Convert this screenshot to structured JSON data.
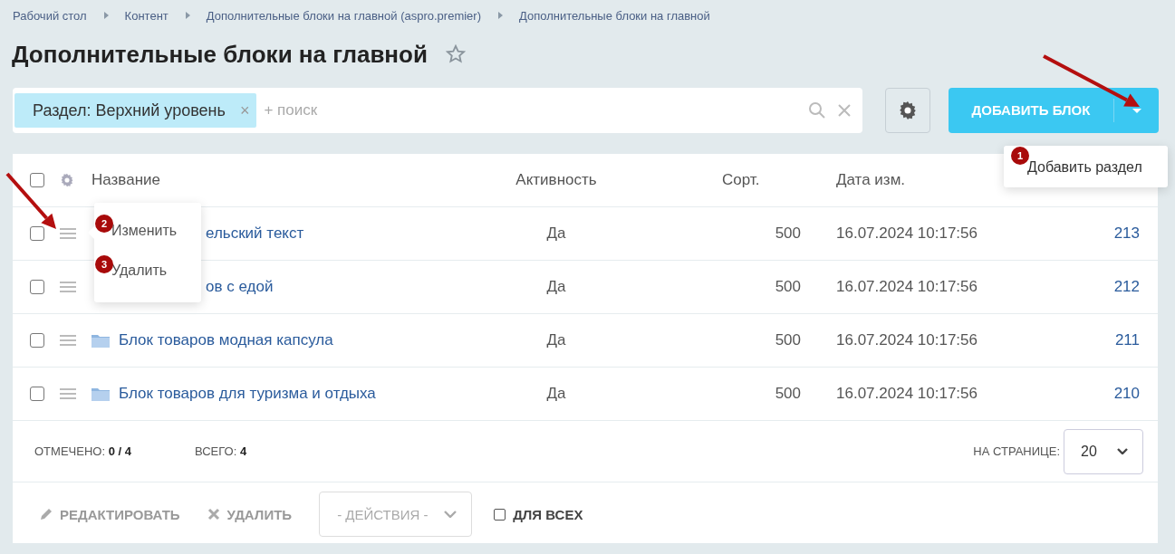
{
  "breadcrumbs": [
    "Рабочий стол",
    "Контент",
    "Дополнительные блоки на главной (aspro.premier)",
    "Дополнительные блоки на главной"
  ],
  "title": "Дополнительные блоки на главной",
  "favorite": false,
  "filter": {
    "tag": "Раздел: Верхний уровень",
    "remove": "×",
    "placeholder": "+ поиск"
  },
  "add_button": {
    "label": "ДОБАВИТЬ БЛОК",
    "menu": [
      {
        "label": "Добавить раздел",
        "badge": "1"
      }
    ]
  },
  "table": {
    "select_all_checked": false,
    "columns": [
      "Название",
      "Активность",
      "Сорт.",
      "Дата изм."
    ],
    "rows": [
      {
        "name": "ельский текст",
        "covered": true,
        "checked": false,
        "active": "Да",
        "sort": "500",
        "date": "16.07.2024 10:17:56",
        "id": "213"
      },
      {
        "name": "ов с едой",
        "covered": true,
        "checked": false,
        "active": "Да",
        "sort": "500",
        "date": "16.07.2024 10:17:56",
        "id": "212"
      },
      {
        "name": "Блок товаров модная капсула",
        "covered": false,
        "checked": false,
        "active": "Да",
        "sort": "500",
        "date": "16.07.2024 10:17:56",
        "id": "211"
      },
      {
        "name": "Блок товаров для туризма и отдыха",
        "covered": false,
        "checked": false,
        "active": "Да",
        "sort": "500",
        "date": "16.07.2024 10:17:56",
        "id": "210"
      }
    ]
  },
  "row_menu": [
    {
      "label": "Изменить",
      "badge": "2"
    },
    {
      "label": "Удалить",
      "badge": "3"
    }
  ],
  "footer": {
    "checked_label": "ОТМЕЧЕНО:",
    "checked_value": "0 / 4",
    "total_label": "ВСЕГО:",
    "total_value": "4",
    "per_page_label": "НА СТРАНИЦЕ:",
    "per_page": "20"
  },
  "actions": {
    "edit": "РЕДАКТИРОВАТЬ",
    "delete": "УДАЛИТЬ",
    "select": "- ДЕЙСТВИЯ -",
    "for_all": "ДЛЯ ВСЕХ",
    "for_all_checked": false
  }
}
